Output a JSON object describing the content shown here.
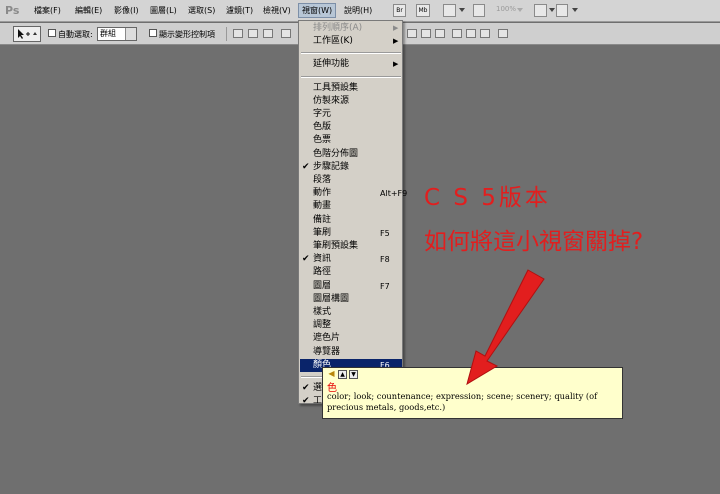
{
  "app": {
    "logo": "Ps"
  },
  "menubar": {
    "items": [
      "檔案(F)",
      "編輯(E)",
      "影像(I)",
      "圖層(L)",
      "選取(S)",
      "濾鏡(T)",
      "檢視(V)",
      "視窗(W)",
      "說明(H)"
    ],
    "active_index": 7,
    "toolbar_badges": [
      "Br",
      "Mb"
    ],
    "zoom": "100%"
  },
  "options": {
    "auto_select_label": "自動選取:",
    "group_value": "群組",
    "show_transform_label": "顯示變形控制項"
  },
  "window_menu": {
    "items": [
      {
        "label": "排列順序(A)",
        "disabled": true,
        "submenu": true
      },
      {
        "label": "工作區(K)",
        "submenu": true
      },
      {
        "divider": true
      },
      {
        "label": "延伸功能",
        "submenu": true
      },
      {
        "divider": true
      },
      {
        "label": "工具預設集"
      },
      {
        "label": "仿製來源"
      },
      {
        "label": "字元"
      },
      {
        "label": "色版"
      },
      {
        "label": "色票"
      },
      {
        "label": "色階分佈圖"
      },
      {
        "label": "步驟記錄",
        "checked": true
      },
      {
        "label": "段落"
      },
      {
        "label": "動作",
        "shortcut": "Alt+F9"
      },
      {
        "label": "動畫"
      },
      {
        "label": "備註"
      },
      {
        "label": "筆刷",
        "shortcut": "F5"
      },
      {
        "label": "筆刷預設集"
      },
      {
        "label": "資訊",
        "checked": true,
        "shortcut": "F8"
      },
      {
        "label": "路徑"
      },
      {
        "label": "圖層",
        "shortcut": "F7"
      },
      {
        "label": "圖層構圖"
      },
      {
        "label": "樣式"
      },
      {
        "label": "調整"
      },
      {
        "label": "遮色片"
      },
      {
        "label": "導覽器"
      },
      {
        "label": "顏色",
        "shortcut": "F6",
        "highlighted": true
      },
      {
        "divider": true
      },
      {
        "label": "選",
        "checked": true
      },
      {
        "label": "工",
        "checked": true
      }
    ]
  },
  "tooltip": {
    "word": "色",
    "definition": "color; look; countenance; expression; scene; scenery; quality (of precious metals, goods,etc.)"
  },
  "annotation": {
    "line1": "C S 5版本",
    "line2": "如何將這小視窗關掉?",
    "color": "#e21e1e"
  }
}
